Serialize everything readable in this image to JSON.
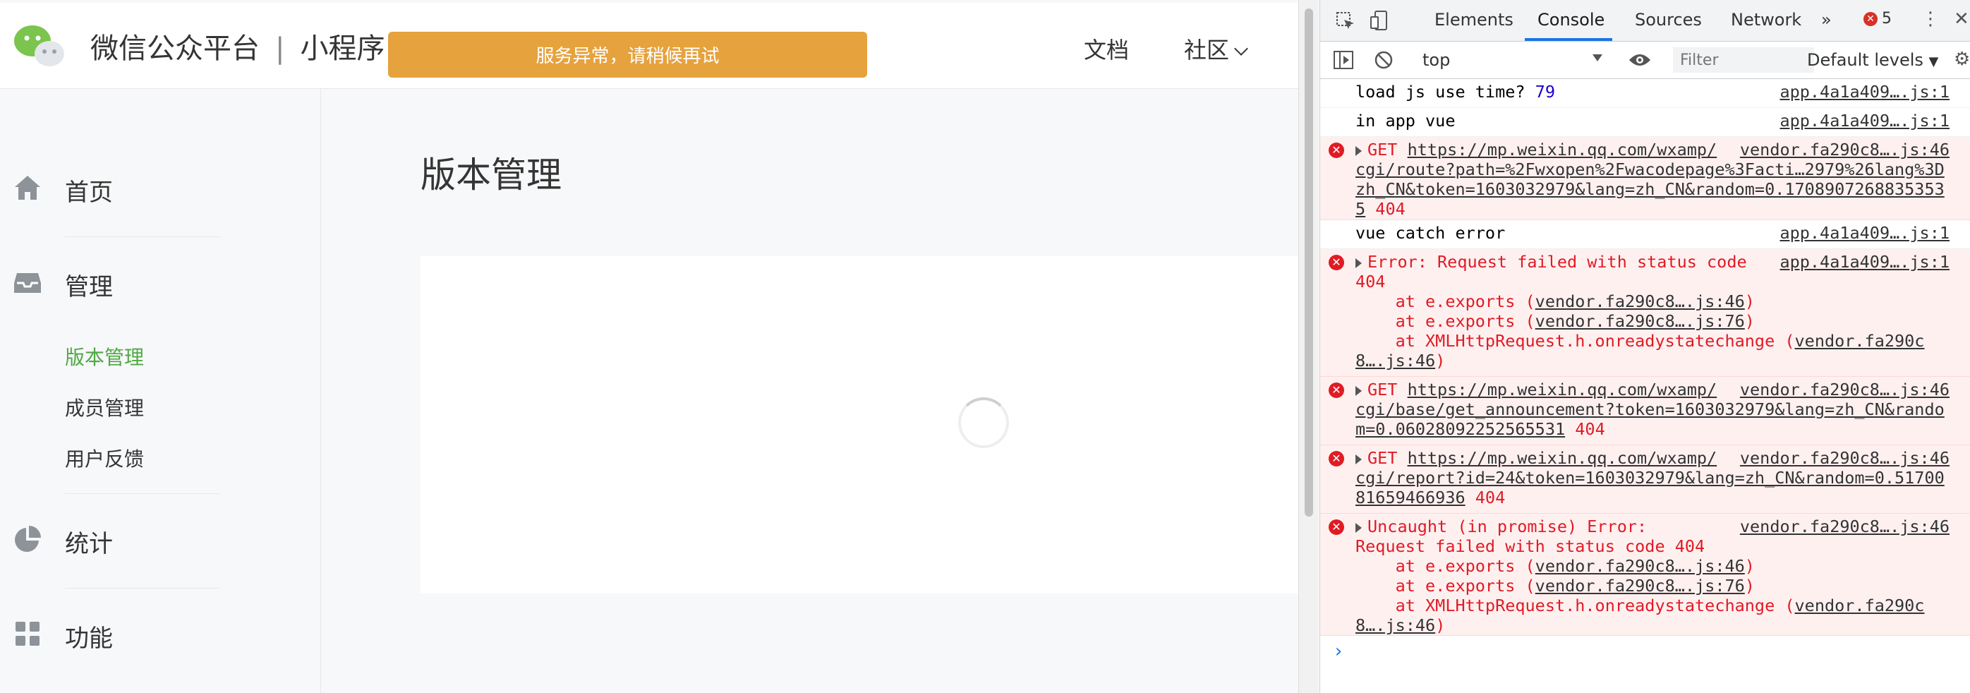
{
  "colors": {
    "accent_green": "#4fa843",
    "banner_orange": "#e6a23c",
    "devtools_blue": "#1a73e8",
    "error_red": "#e01b24"
  },
  "header": {
    "brand": "微信公众平台",
    "separator": "|",
    "product": "小程序",
    "banner": "服务异常，请稍候再试",
    "docs": "文档",
    "community": "社区"
  },
  "sidebar": {
    "home": "首页",
    "manage": "管理",
    "version_mgmt": "版本管理",
    "member_mgmt": "成员管理",
    "feedback": "用户反馈",
    "stats": "统计",
    "features": "功能"
  },
  "main": {
    "title": "版本管理"
  },
  "devtools": {
    "tabs": [
      "Elements",
      "Console",
      "Sources",
      "Network"
    ],
    "more": "»",
    "error_count": "5",
    "context": "top",
    "filter_placeholder": "Filter",
    "levels": "Default levels",
    "console": {
      "r1_text": "load js use time? ",
      "r1_num": "79",
      "r1_src": "app.4a1a409….js:1",
      "r2_text": "in app vue",
      "r2_src": "app.4a1a409….js:1",
      "r3_method": "GET ",
      "r3_url1": "https://mp.weixin.qq.com/wxamp/",
      "r3_url2": "cgi/route?path=%2Fwxopen%2Fwacodepage%3Facti…2979%26lang%3D",
      "r3_url3": "zh_CN&token=1603032979&lang=zh_CN&random=0.1708907268835353",
      "r3_url4": "5",
      "r3_status": " 404",
      "r3_src": "vendor.fa290c8….js:46",
      "r4_text": "vue catch error",
      "r4_src": "app.4a1a409….js:1",
      "r5_l1": "Error: Request failed with status code",
      "r5_l2": "404",
      "r5_at1": "    at e.exports (",
      "r5_at1_link": "vendor.fa290c8….js:46",
      "r5_at2": "    at e.exports (",
      "r5_at2_link": "vendor.fa290c8….js:76",
      "r5_at3": "    at XMLHttpRequest.h.onreadystatechange (",
      "r5_at3_link1": "vendor.fa290c",
      "r5_at3_link2": "8….js:46",
      "r5_src": "app.4a1a409….js:1",
      "r6_method": "GET ",
      "r6_url1": "https://mp.weixin.qq.com/wxamp/",
      "r6_url2": "cgi/base/get_announcement?token=1603032979&lang=zh_CN&rando",
      "r6_url3": "m=0.06028092252565531",
      "r6_status": " 404",
      "r6_src": "vendor.fa290c8….js:46",
      "r7_method": "GET ",
      "r7_url1": "https://mp.weixin.qq.com/wxamp/",
      "r7_url2": "cgi/report?id=24&token=1603032979&lang=zh_CN&random=0.51700",
      "r7_url3": "81659466936",
      "r7_status": " 404",
      "r7_src": "vendor.fa290c8….js:46",
      "r8_l1": "Uncaught (in promise) Error:",
      "r8_l2": "Request failed with status code 404",
      "r8_at1": "    at e.exports (",
      "r8_at1_link": "vendor.fa290c8….js:46",
      "r8_at2": "    at e.exports (",
      "r8_at2_link": "vendor.fa290c8….js:76",
      "r8_at3": "    at XMLHttpRequest.h.onreadystatechange (",
      "r8_at3_link1": "vendor.fa290c",
      "r8_at3_link2": "8….js:46",
      "r8_src": "vendor.fa290c8….js:46",
      "prompt": "›"
    }
  }
}
